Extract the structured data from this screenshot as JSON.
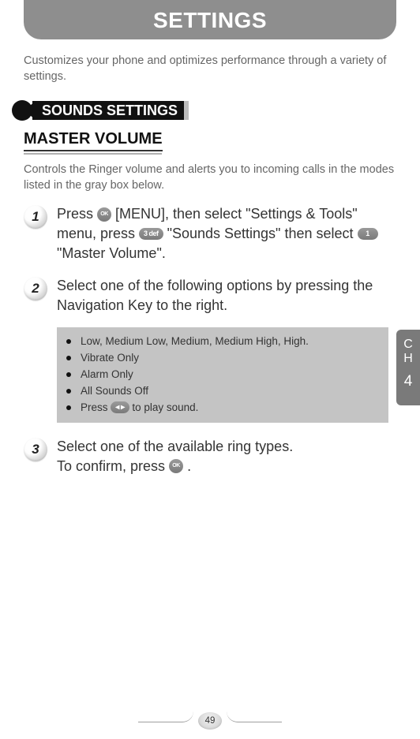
{
  "header": {
    "title": "SETTINGS"
  },
  "intro": "Customizes your phone and optimizes performance through a variety of settings.",
  "section": {
    "label": "SOUNDS SETTINGS"
  },
  "subheading": "MASTER VOLUME",
  "sub_intro": "Controls the Ringer volume and alerts you to incoming calls in the modes listed in the gray box below.",
  "steps": {
    "s1": {
      "num": "1",
      "t1": "Press ",
      "key1": "OK",
      "t2": " [MENU], then select \"Settings & Tools\" menu, press ",
      "key2": "3 def",
      "t3": " \"Sounds Settings\" then select ",
      "key3": "1",
      "t4": " \"Master Volume\"."
    },
    "s2": {
      "num": "2",
      "text": "Select one of the following options by pressing the Navigation Key to the right."
    },
    "s3": {
      "num": "3",
      "t1": "Select one of the available ring types.",
      "t2": "To confirm, press ",
      "key1": "OK",
      "t3": " ."
    }
  },
  "options": {
    "o1": "Low, Medium Low, Medium, Medium High, High.",
    "o2": "Vibrate Only",
    "o3": "Alarm Only",
    "o4": "All Sounds Off",
    "o5_a": "Press ",
    "o5_b": " to play sound."
  },
  "side_tab": {
    "c": "C",
    "h": "H",
    "num": "4"
  },
  "page_number": "49"
}
